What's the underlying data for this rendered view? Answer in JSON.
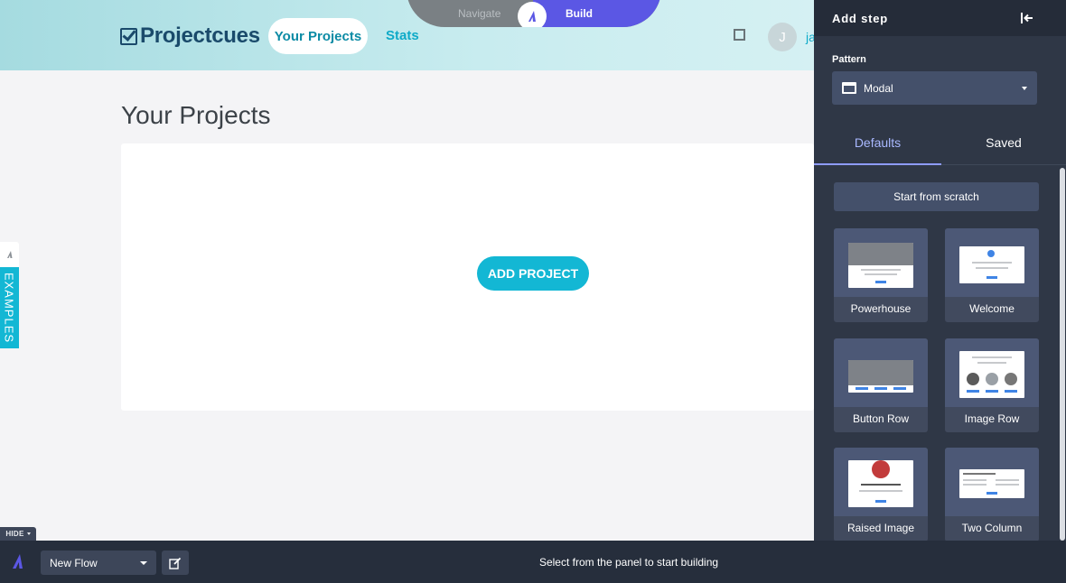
{
  "header": {
    "logo_text": "Projectcues",
    "nav_active": "Your Projects",
    "nav_stats": "Stats",
    "avatar_initial": "J",
    "user_fragment": "ja"
  },
  "mode_switch": {
    "navigate_label": "Navigate",
    "build_label": "Build",
    "active": "Build"
  },
  "main": {
    "page_title": "Your Projects",
    "add_project_label": "ADD PROJECT",
    "examples_tab_label": "EXAMPLES"
  },
  "panel": {
    "title": "Add step",
    "pattern_label": "Pattern",
    "pattern_value": "Modal",
    "tabs": [
      {
        "label": "Defaults",
        "active": true
      },
      {
        "label": "Saved",
        "active": false
      }
    ],
    "start_from_scratch_label": "Start from scratch",
    "templates": [
      {
        "label": "Powerhouse"
      },
      {
        "label": "Welcome"
      },
      {
        "label": "Button Row"
      },
      {
        "label": "Image Row"
      },
      {
        "label": "Raised Image"
      },
      {
        "label": "Two Column"
      }
    ]
  },
  "bottombar": {
    "hide_label": "HIDE",
    "flow_value": "New Flow",
    "status_text": "Select from the panel to start building"
  },
  "colors": {
    "accent_cyan": "#13b7d4",
    "build_purple": "#5b57e4",
    "panel_bg": "#2f3746",
    "tab_active": "#a9b8ff"
  },
  "icons": [
    "logo-check-icon",
    "square-icon",
    "mode-build-icon",
    "collapse-panel-icon",
    "modal-pattern-icon",
    "chevron-down-icon",
    "brand-icon",
    "edit-icon",
    "examples-icon"
  ]
}
